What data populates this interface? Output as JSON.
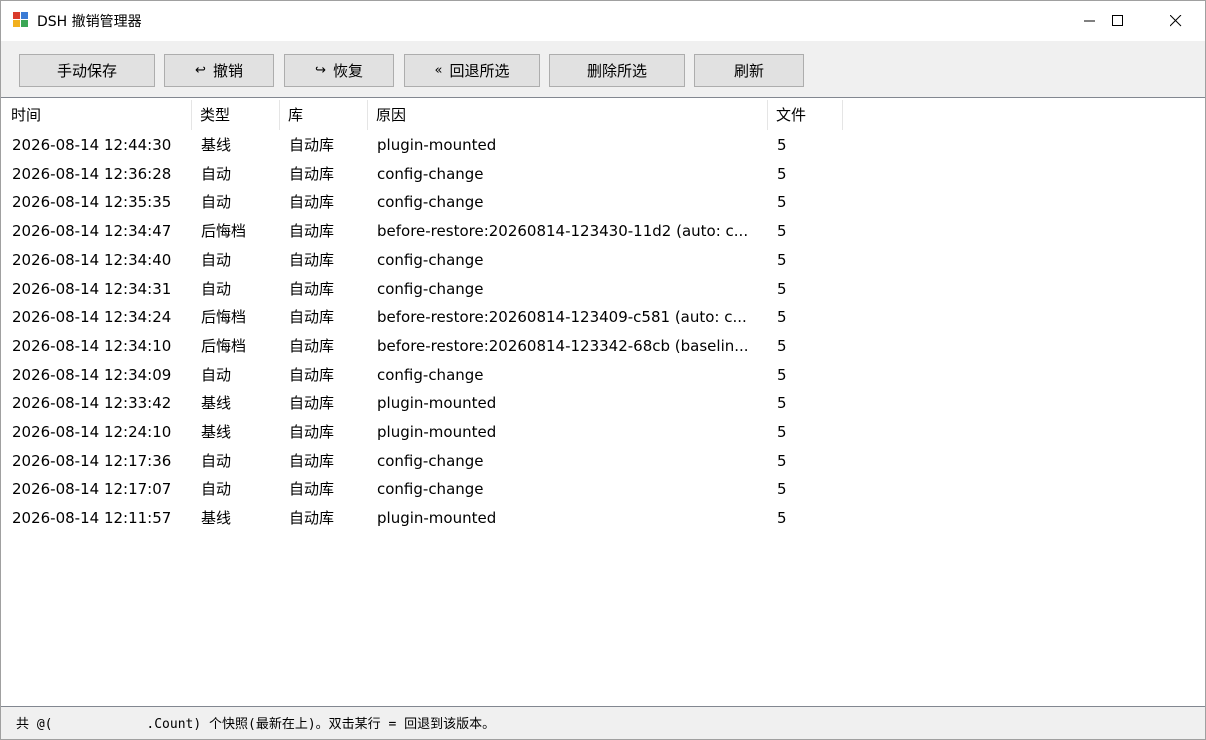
{
  "window": {
    "title": "DSH 撤销管理器",
    "icon": "app-window-icon",
    "controls": [
      "minimize-icon",
      "maximize-icon",
      "close-icon"
    ]
  },
  "toolbar": {
    "manual_save": "手动保存",
    "undo": "撤销",
    "redo": "恢复",
    "rollback": "回退所选",
    "delete_selected": "删除所选",
    "refresh": "刷新",
    "undo_icon": "↩",
    "redo_icon": "↪",
    "rollback_icon": "«"
  },
  "list": {
    "columns": [
      "时间",
      "类型",
      "库",
      "原因",
      "文件"
    ],
    "rows": [
      [
        "2026-08-14 12:44:30",
        "基线",
        "自动库",
        "plugin-mounted",
        "5"
      ],
      [
        "2026-08-14 12:36:28",
        "自动",
        "自动库",
        "config-change",
        "5"
      ],
      [
        "2026-08-14 12:35:35",
        "自动",
        "自动库",
        "config-change",
        "5"
      ],
      [
        "2026-08-14 12:34:47",
        "后悔档",
        "自动库",
        "before-restore:20260814-123430-11d2 (auto: c...",
        "5"
      ],
      [
        "2026-08-14 12:34:40",
        "自动",
        "自动库",
        "config-change",
        "5"
      ],
      [
        "2026-08-14 12:34:31",
        "自动",
        "自动库",
        "config-change",
        "5"
      ],
      [
        "2026-08-14 12:34:24",
        "后悔档",
        "自动库",
        "before-restore:20260814-123409-c581 (auto: c...",
        "5"
      ],
      [
        "2026-08-14 12:34:10",
        "后悔档",
        "自动库",
        "before-restore:20260814-123342-68cb (baselin...",
        "5"
      ],
      [
        "2026-08-14 12:34:09",
        "自动",
        "自动库",
        "config-change",
        "5"
      ],
      [
        "2026-08-14 12:33:42",
        "基线",
        "自动库",
        "plugin-mounted",
        "5"
      ],
      [
        "2026-08-14 12:24:10",
        "基线",
        "自动库",
        "plugin-mounted",
        "5"
      ],
      [
        "2026-08-14 12:17:36",
        "自动",
        "自动库",
        "config-change",
        "5"
      ],
      [
        "2026-08-14 12:17:07",
        "自动",
        "自动库",
        "config-change",
        "5"
      ],
      [
        "2026-08-14 12:11:57",
        "基线",
        "自动库",
        "plugin-mounted",
        "5"
      ]
    ]
  },
  "status": {
    "text": "共 @(            .Count) 个快照(最新在上)。双击某行 = 回退到该版本。"
  },
  "colors": {
    "window_bg": "#f0f0f0",
    "button_bg": "#e1e1e1",
    "button_border": "#adadad",
    "list_bg": "#ffffff"
  }
}
